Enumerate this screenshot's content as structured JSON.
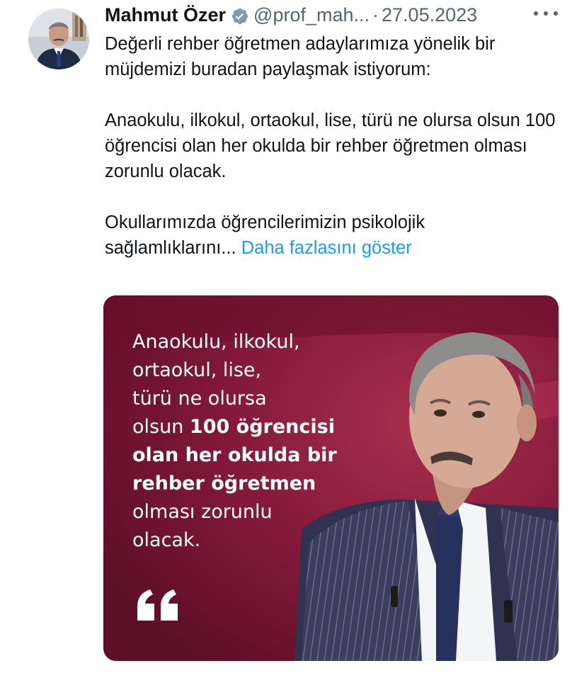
{
  "tweet": {
    "author_name": "Mahmut Özer",
    "handle": "@prof_mah...",
    "separator": "·",
    "date": "27.05.2023",
    "paragraphs": [
      "Değerli rehber öğretmen adaylarımıza yönelik bir müjdemizi buradan paylaşmak istiyorum:",
      "Anaokulu, ilkokul, ortaokul, lise, türü ne olursa olsun 100 öğrencisi olan her okulda bir rehber öğretmen olması zorunlu olacak.",
      "Okullarımızda öğrencilerimizin psikolojik sağlamlıklarını..."
    ],
    "show_more": "Daha fazlasını göster"
  },
  "media": {
    "quote_lines": [
      {
        "normal": "Anaokulu, ilkokul,",
        "bold": ""
      },
      {
        "normal": "ortaokul, lise,",
        "bold": ""
      },
      {
        "normal": "türü ne olursa",
        "bold": ""
      },
      {
        "normal": "olsun ",
        "bold": "100 öğrencisi"
      },
      {
        "normal": "",
        "bold": "olan her okulda bir"
      },
      {
        "normal": "",
        "bold": "rehber öğretmen"
      },
      {
        "normal": "olması zorunlu",
        "bold": ""
      },
      {
        "normal": "olacak.",
        "bold": ""
      }
    ],
    "quote_mark": "“",
    "background_color": "#7c1632"
  },
  "colors": {
    "text": "#0f1419",
    "secondary": "#536471",
    "link": "#1d9bf0",
    "verified": "#829aab"
  },
  "icons": {
    "verified": "verified-badge-icon",
    "more": "more-options-icon",
    "quote": "quote-mark-icon"
  }
}
